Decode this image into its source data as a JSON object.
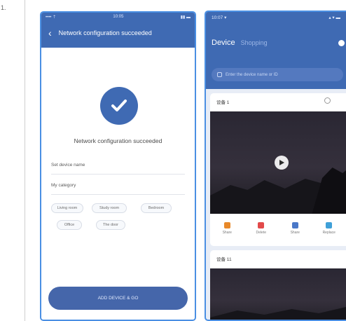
{
  "corner_mark": "1.",
  "phone1": {
    "status": {
      "left": "•••• ⇡",
      "time": "10:05",
      "right": "▮▮ ▬"
    },
    "nav_title": "Network configuration succeeded",
    "success_message": "Network configuration succeeded",
    "device_name_label": "Set device name",
    "category_label": "My category",
    "chips": [
      "Living room",
      "Study room",
      "Bedroom",
      "Office",
      "The door"
    ],
    "add_button_label": "ADD DEVICE & GO"
  },
  "phone2": {
    "status": {
      "time": "10:07 ▾",
      "right": "▴ ▾ ▬"
    },
    "tabs": {
      "active": "Device",
      "inactive": "Shopping"
    },
    "search_placeholder": "Enter the device name or ID",
    "devices": [
      {
        "name": "设备 1"
      },
      {
        "name": "设备 11"
      }
    ],
    "actions": [
      {
        "label": "Share",
        "color": "#e8892a"
      },
      {
        "label": "Delete",
        "color": "#e24a4a"
      },
      {
        "label": "Share",
        "color": "#4a78c8"
      },
      {
        "label": "Replace",
        "color": "#3fa0d8"
      }
    ]
  }
}
